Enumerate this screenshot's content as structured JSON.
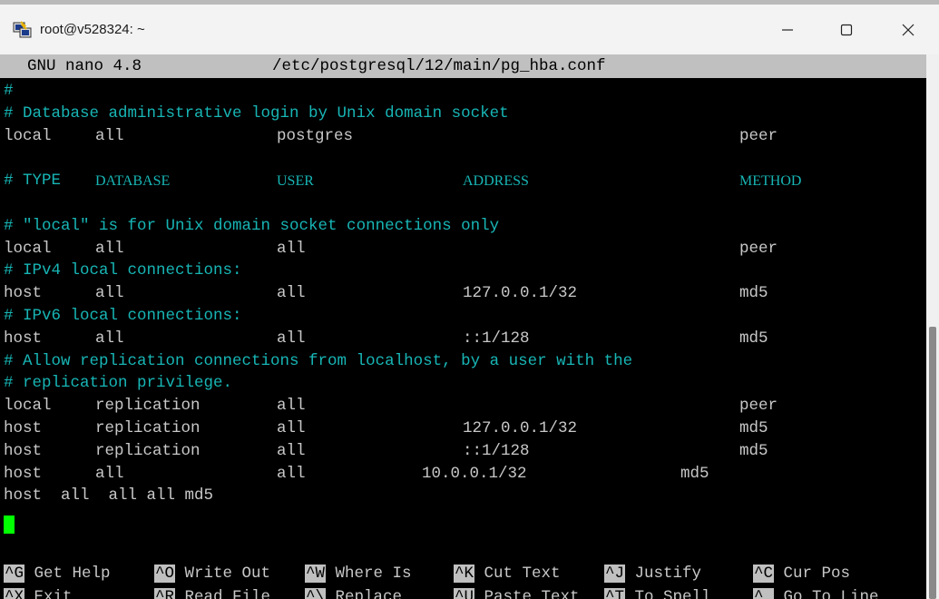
{
  "window": {
    "title": "root@v528324: ~",
    "icon": "putty-icon",
    "controls": [
      "minimize-icon",
      "maximize-icon",
      "close-icon"
    ]
  },
  "nano": {
    "version": "GNU nano 4.8",
    "filename": "/etc/postgresql/12/main/pg_hba.conf"
  },
  "lines": [
    {
      "kind": "comment",
      "cells": [
        "#"
      ]
    },
    {
      "kind": "comment",
      "cells": [
        "# Database administrative login by Unix domain socket"
      ]
    },
    {
      "kind": "entry",
      "cells": [
        "local",
        "all",
        "postgres",
        "",
        "peer"
      ]
    },
    {
      "kind": "blank",
      "cells": []
    },
    {
      "kind": "header",
      "cells": [
        "# TYPE",
        "DATABASE",
        "USER",
        "ADDRESS",
        "METHOD"
      ]
    },
    {
      "kind": "blank",
      "cells": []
    },
    {
      "kind": "comment",
      "cells": [
        "# \"local\" is for Unix domain socket connections only"
      ]
    },
    {
      "kind": "entry",
      "cells": [
        "local",
        "all",
        "all",
        "",
        "peer"
      ]
    },
    {
      "kind": "comment",
      "cells": [
        "# IPv4 local connections:"
      ]
    },
    {
      "kind": "entry",
      "cells": [
        "host",
        "all",
        "all",
        "127.0.0.1/32",
        "md5"
      ]
    },
    {
      "kind": "comment",
      "cells": [
        "# IPv6 local connections:"
      ]
    },
    {
      "kind": "entry",
      "cells": [
        "host",
        "all",
        "all",
        "::1/128",
        "md5"
      ]
    },
    {
      "kind": "comment",
      "cells": [
        "# Allow replication connections from localhost, by a user with the"
      ]
    },
    {
      "kind": "comment",
      "cells": [
        "# replication privilege."
      ]
    },
    {
      "kind": "entry",
      "cells": [
        "local",
        "replication",
        "all",
        "",
        "peer"
      ]
    },
    {
      "kind": "entry",
      "cells": [
        "host",
        "replication",
        "all",
        "127.0.0.1/32",
        "md5"
      ]
    },
    {
      "kind": "entry",
      "cells": [
        "host",
        "replication",
        "all",
        "::1/128",
        "md5"
      ]
    },
    {
      "kind": "entry-shifted",
      "cells": [
        "host",
        "all",
        "all",
        "10.0.0.1/32",
        "md5"
      ]
    },
    {
      "kind": "raw",
      "cells": [
        "host  all  all all md5"
      ]
    }
  ],
  "shortcuts": [
    {
      "key": "^G",
      "label": "Get Help"
    },
    {
      "key": "^O",
      "label": "Write Out"
    },
    {
      "key": "^W",
      "label": "Where Is"
    },
    {
      "key": "^K",
      "label": "Cut Text"
    },
    {
      "key": "^J",
      "label": "Justify"
    },
    {
      "key": "^C",
      "label": "Cur Pos"
    },
    {
      "key": "^X",
      "label": "Exit"
    },
    {
      "key": "^R",
      "label": "Read File"
    },
    {
      "key": "^\\",
      "label": "Replace"
    },
    {
      "key": "^U",
      "label": "Paste Text"
    },
    {
      "key": "^T",
      "label": "To Spell"
    },
    {
      "key": "^_",
      "label": "Go To Line"
    }
  ],
  "colors": {
    "comment": "#18b5b5",
    "text": "#c8c8c8",
    "cursor": "#00ff00",
    "header_bar": "#c0c0c0",
    "background": "#000000"
  }
}
